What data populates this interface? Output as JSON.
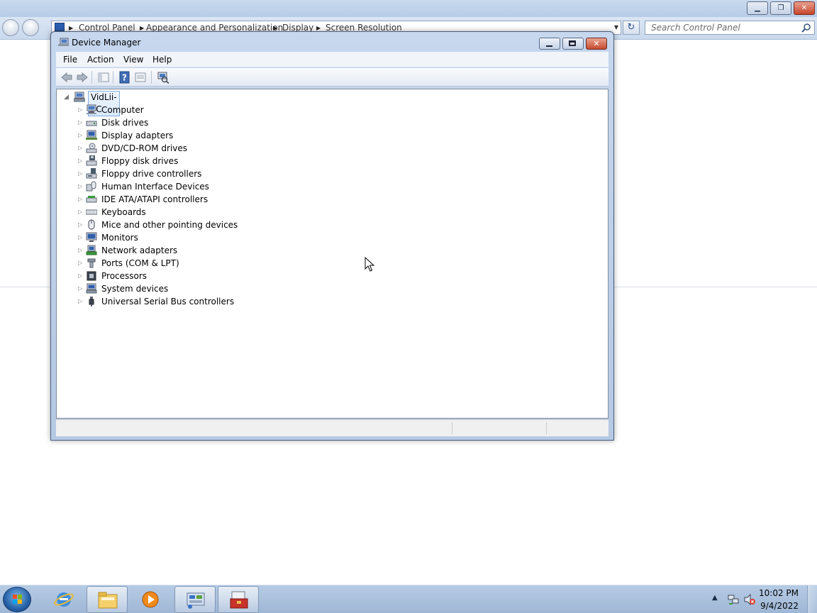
{
  "control_panel": {
    "breadcrumb": [
      "Control Panel",
      "Appearance and Personalization",
      "Display",
      "Screen Resolution"
    ],
    "search_placeholder": "Search Control Panel",
    "refresh_glyph": "↻"
  },
  "device_manager": {
    "title": "Device Manager",
    "menu": [
      "File",
      "Action",
      "View",
      "Help"
    ],
    "close_glyph": "✕",
    "root": "VidLii-PC",
    "categories": [
      {
        "label": "Computer",
        "icon": "computer-icon"
      },
      {
        "label": "Disk drives",
        "icon": "disk-drive-icon"
      },
      {
        "label": "Display adapters",
        "icon": "display-adapter-icon"
      },
      {
        "label": "DVD/CD-ROM drives",
        "icon": "dvd-drive-icon"
      },
      {
        "label": "Floppy disk drives",
        "icon": "floppy-disk-icon"
      },
      {
        "label": "Floppy drive controllers",
        "icon": "floppy-controller-icon"
      },
      {
        "label": "Human Interface Devices",
        "icon": "hid-icon"
      },
      {
        "label": "IDE ATA/ATAPI controllers",
        "icon": "ide-controller-icon"
      },
      {
        "label": "Keyboards",
        "icon": "keyboard-icon"
      },
      {
        "label": "Mice and other pointing devices",
        "icon": "mouse-icon"
      },
      {
        "label": "Monitors",
        "icon": "monitor-icon"
      },
      {
        "label": "Network adapters",
        "icon": "network-adapter-icon"
      },
      {
        "label": "Ports (COM & LPT)",
        "icon": "port-icon"
      },
      {
        "label": "Processors",
        "icon": "processor-icon"
      },
      {
        "label": "System devices",
        "icon": "system-device-icon"
      },
      {
        "label": "Universal Serial Bus controllers",
        "icon": "usb-icon"
      }
    ]
  },
  "taskbar": {
    "time": "10:02 PM",
    "date": "9/4/2022",
    "pinned": [
      "internet-explorer-icon",
      "windows-explorer-icon",
      "media-player-icon",
      "control-panel-icon",
      "device-manager-icon"
    ]
  },
  "colors": {
    "window_frame": "#b5c9e4",
    "taskbar": "#9fb7d6",
    "selection": "#d9e9fb"
  }
}
